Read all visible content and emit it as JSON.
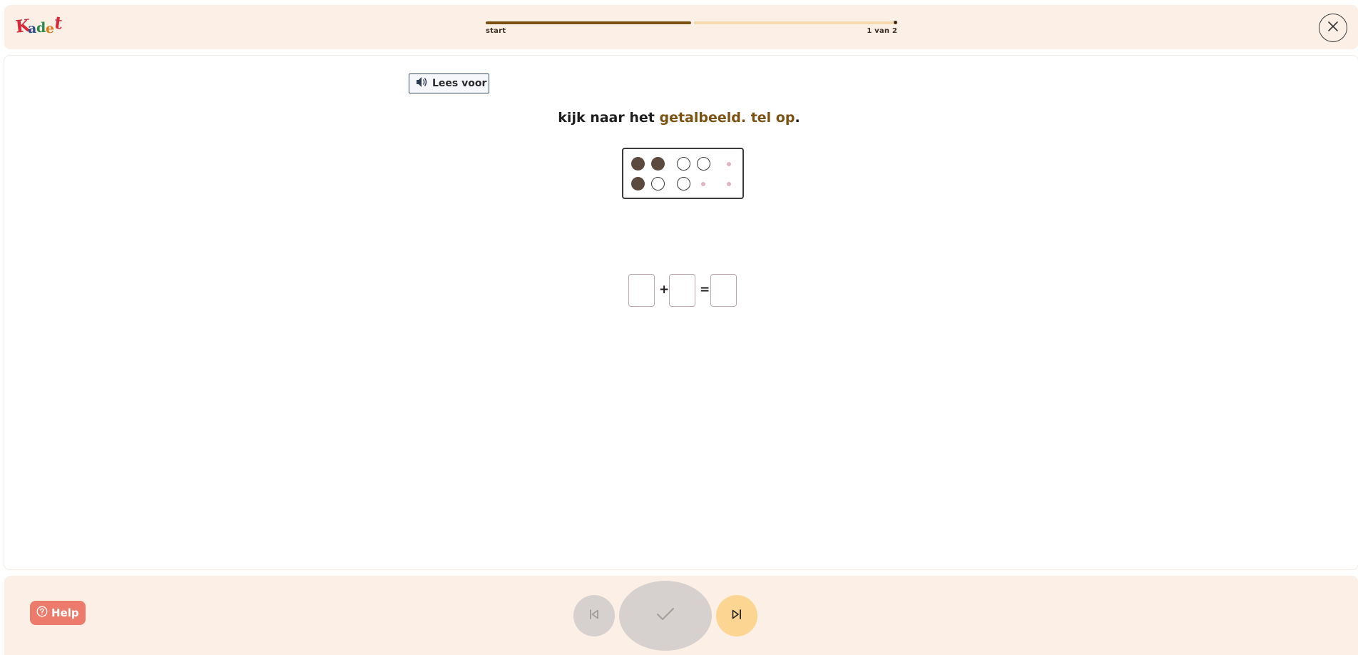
{
  "header": {
    "logo_text": "Kadet",
    "progress": {
      "start_label": "start",
      "count_label": "1 van 2",
      "current": 1,
      "total": 2
    }
  },
  "exercise": {
    "read_aloud_label": "Lees voor",
    "question": {
      "part1": "kijk naar het ",
      "highlight": "getalbeeld. tel op",
      "end": "."
    },
    "number_image": {
      "row1": [
        "filled",
        "filled",
        "empty",
        "empty",
        "tiny"
      ],
      "row2": [
        "filled",
        "empty",
        "empty",
        "tiny",
        "tiny"
      ]
    },
    "equation": {
      "operator_plus": "+",
      "operator_equals": "=",
      "box1": "",
      "box2": "",
      "box3": ""
    }
  },
  "footer": {
    "help_label": "Help"
  },
  "colors": {
    "accent_brown": "#7a5212",
    "progress_done": "#7a4f12",
    "progress_rest": "#f6d9ad",
    "help_bg": "#ec7b6b",
    "next_bg": "#fbd591",
    "disabled_bg": "#d6d1ce",
    "panel_bg": "#fbefe6"
  },
  "icons": {
    "close": "close-icon",
    "speaker": "speaker-icon",
    "help": "help-icon",
    "prev": "skip-back-icon",
    "check": "check-icon",
    "next": "skip-forward-icon"
  }
}
